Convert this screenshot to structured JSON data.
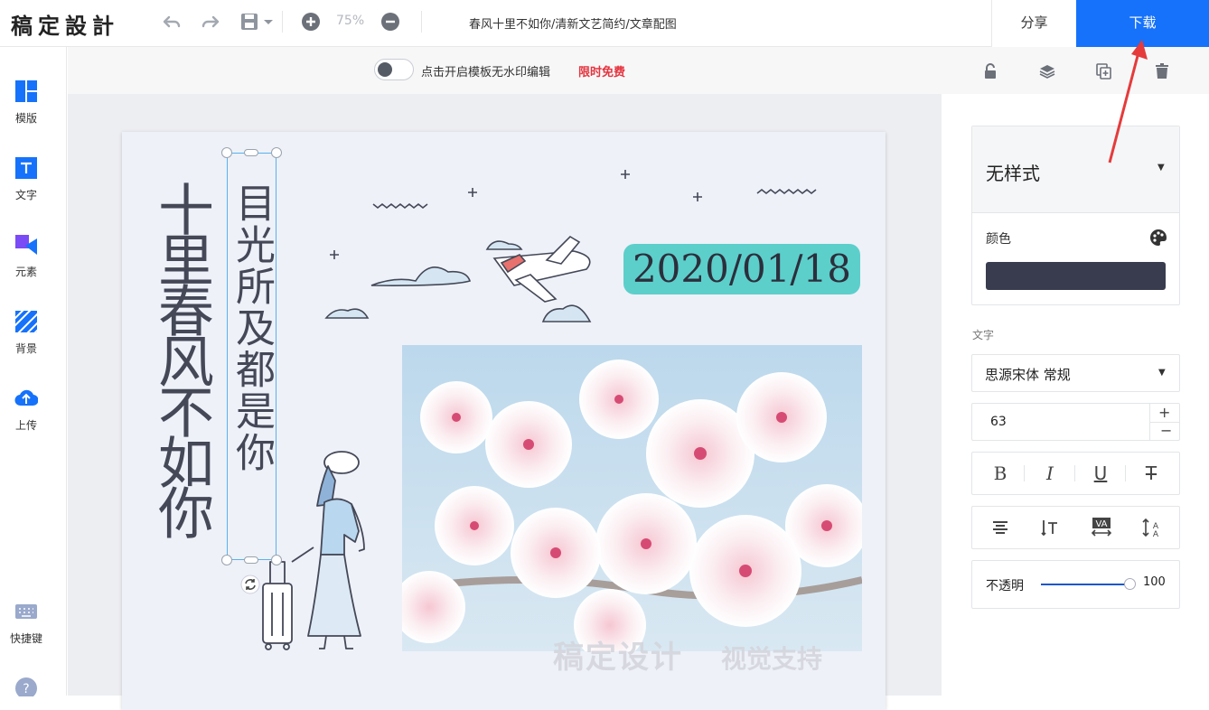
{
  "app": {
    "logo": "稿定設計",
    "zoom": "75%",
    "doc_title": "春风十里不如你/清新文艺简约/文章配图",
    "share": "分享",
    "download": "下载"
  },
  "sidebar": [
    {
      "label": "模版",
      "icon": "template-icon"
    },
    {
      "label": "文字",
      "icon": "text-icon"
    },
    {
      "label": "元素",
      "icon": "elements-icon"
    },
    {
      "label": "背景",
      "icon": "background-icon"
    },
    {
      "label": "上传",
      "icon": "upload-icon"
    },
    {
      "label": "快捷键",
      "icon": "keyboard-icon"
    }
  ],
  "toolstrip": {
    "watermark_text": "点击开启模板无水印编辑",
    "watermark_free": "限时免费"
  },
  "canvas": {
    "title_vertical": "十里春风不如你",
    "subtitle_vertical": "目光所及都是你",
    "date": "2020/01/18",
    "watermark_main": "稿定设计",
    "watermark_sub": "视觉支持"
  },
  "panel": {
    "style_label": "无样式",
    "color_label": "颜色",
    "color_value": "#393c4e",
    "text_section": "文字",
    "font_name": "思源宋体 常规",
    "font_size": "63",
    "opacity_label": "不透明",
    "opacity_value": "100"
  },
  "colors": {
    "accent": "#1672fa",
    "badge": "#5ccfcb",
    "free": "#e5343f"
  }
}
